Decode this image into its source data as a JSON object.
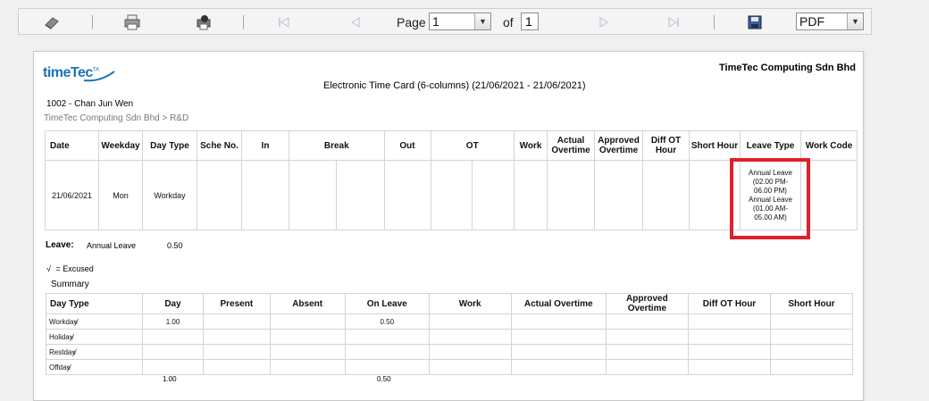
{
  "toolbar": {
    "page_label": "Page",
    "page_value": "1",
    "of_label": "of",
    "total_pages": "1",
    "format_value": "PDF"
  },
  "report": {
    "logo_text": "timeTec",
    "logo_tag": "TA",
    "company": "TimeTec Computing Sdn Bhd",
    "title": "Electronic Time Card (6-columns)  (21/06/2021 - 21/06/2021)",
    "employee": "1002 - Chan Jun Wen",
    "department": "TimeTec Computing Sdn Bhd > R&D"
  },
  "timecard": {
    "headers": {
      "date": "Date",
      "weekday": "Weekday",
      "daytype": "Day Type",
      "sche": "Sche No.",
      "in": "In",
      "break": "Break",
      "out": "Out",
      "ot": "OT",
      "work": "Work",
      "actual_ot": "Actual Overtime",
      "approved_ot": "Approved Overtime",
      "diff_ot": "Diff OT Hour",
      "short": "Short Hour",
      "leave_type": "Leave Type",
      "work_code": "Work Code"
    },
    "row": {
      "date": "21/06/2021",
      "weekday": "Mon",
      "daytype": "Workday",
      "leave_1": "Annual Leave",
      "leave_1_time": "(02.00 PM-06.00 PM)",
      "leave_2": "Annual Leave",
      "leave_2_time": "(01.00 AM-05.00 AM)"
    }
  },
  "leave": {
    "label": "Leave:",
    "type": "Annual Leave",
    "value": "0.50"
  },
  "legend": {
    "symbol": "√",
    "text": "= Excused"
  },
  "summary": {
    "title": "Summary",
    "headers": {
      "daytype": "Day Type",
      "day": "Day",
      "present": "Present",
      "absent": "Absent",
      "onleave": "On Leave",
      "work": "Work",
      "actual_ot": "Actual Overtime",
      "approved_ot": "Approved Overtime",
      "diff_ot": "Diff OT Hour",
      "short": "Short Hour"
    },
    "rows": [
      {
        "type": "Workday",
        "day": "1.00",
        "onleave": "0.50"
      },
      {
        "type": "Holiday",
        "day": "",
        "onleave": ""
      },
      {
        "type": "Restday",
        "day": "",
        "onleave": ""
      },
      {
        "type": "Offday",
        "day": "",
        "onleave": ""
      }
    ],
    "totals": {
      "day": "1.00",
      "onleave": "0.50"
    }
  },
  "colors": {
    "highlight": "#e0202a",
    "logo_blue": "#1a73b8"
  }
}
